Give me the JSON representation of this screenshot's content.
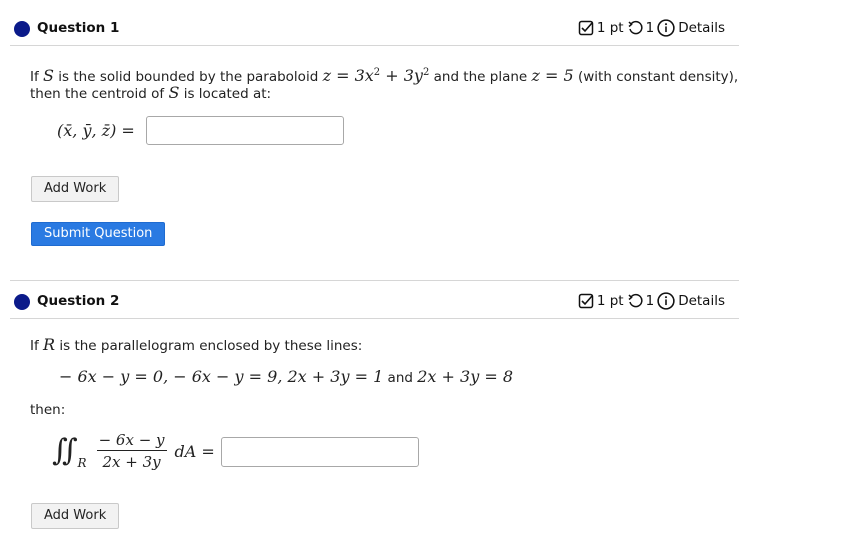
{
  "question1": {
    "title": "Question 1",
    "points": "1 pt",
    "attempts": "1",
    "details_label": "Details",
    "text_line1_pre": "If ",
    "var_S": "S",
    "text_line1_mid": " is the solid bounded by the paraboloid ",
    "eq_paraboloid_a": "z = 3x",
    "eq_paraboloid_b": " + 3y",
    "exp2": "2",
    "text_line1_post1": " and the plane ",
    "eq_plane": "z = 5",
    "text_line1_post2": " (with constant density),",
    "text_line2_pre": "then the centroid of ",
    "text_line2_post": " is located at:",
    "answer_label": "(x̄, ȳ, z̄) =",
    "answer_value": "",
    "add_work_label": "Add Work",
    "submit_label": "Submit Question"
  },
  "question2": {
    "title": "Question 2",
    "points": "1 pt",
    "attempts": "1",
    "details_label": "Details",
    "text_pre": "If ",
    "var_R": "R",
    "text_post": " is the parallelogram enclosed by these lines:",
    "lines_eq": "− 6x − y = 0,  − 6x − y = 9,  2x + 3y = 1",
    "and_word": " and ",
    "last_eq": "2x + 3y = 8",
    "then_label": "then:",
    "integral_sign": "∬",
    "region_sub": "R",
    "frac_num": "− 6x − y",
    "frac_den": "2x + 3y",
    "dA": "dA =",
    "answer_value": "",
    "add_work_label": "Add Work"
  },
  "colors": {
    "dot": "#0b1a8a",
    "submit": "#2a7ae2"
  }
}
